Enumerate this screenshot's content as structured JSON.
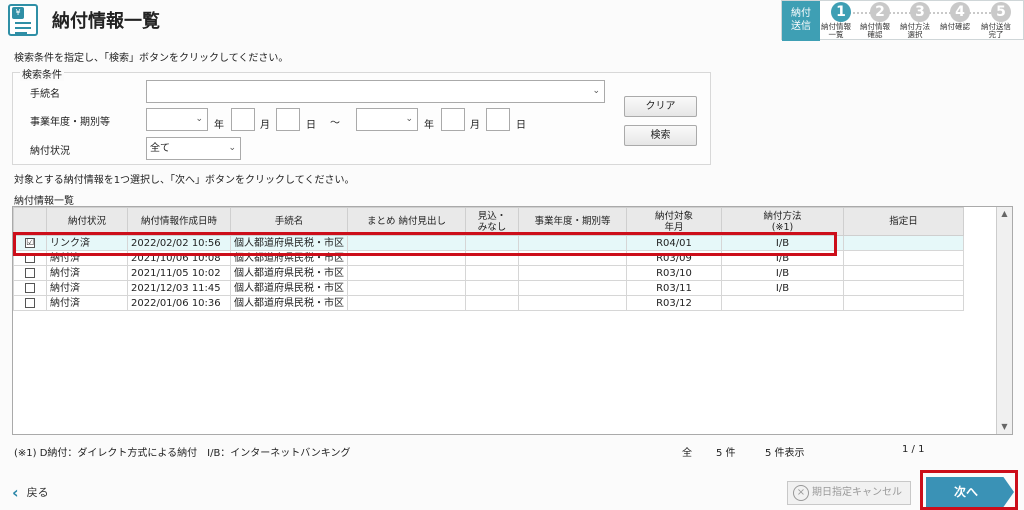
{
  "header": {
    "title": "納付情報一覧",
    "icon": "yen-document-icon"
  },
  "steps": {
    "current_label": "納付\n送信",
    "items": [
      {
        "num": "1",
        "label": "納付情報\n一覧"
      },
      {
        "num": "2",
        "label": "納付情報\n確認"
      },
      {
        "num": "3",
        "label": "納付方法\n選択"
      },
      {
        "num": "4",
        "label": "納付確認"
      },
      {
        "num": "5",
        "label": "納付送信\n完了"
      }
    ]
  },
  "instructions": {
    "search": "検索条件を指定し、「検索」ボタンをクリックしてください。",
    "select": "対象とする納付情報を1つ選択し、「次へ」ボタンをクリックしてください。"
  },
  "search": {
    "legend": "検索条件",
    "procedure_label": "手続名",
    "procedure_value": "",
    "period_label": "事業年度・期別等",
    "year_unit": "年",
    "month_unit": "月",
    "day_unit": "日",
    "tilde": "～",
    "status_label": "納付状況",
    "status_value": "全て",
    "clear_button": "クリア",
    "search_button": "検索"
  },
  "list": {
    "title": "納付情報一覧",
    "headers": [
      "",
      "納付状況",
      "納付情報作成日時",
      "手続名",
      "まとめ 納付見出し",
      "見込・\nみなし",
      "事業年度・期別等",
      "納付対象\n年月",
      "納付方法\n(※1)",
      "指定日"
    ],
    "rows": [
      {
        "checked": "☑",
        "status": "リンク済",
        "created": "2022/02/02 10:56",
        "procedure": "個人都道府県民税・市区",
        "summary": "",
        "estimate": "",
        "period": "",
        "target": "R04/01",
        "method": "I/B",
        "date": ""
      },
      {
        "checked": "",
        "status": "納付済",
        "created": "2021/10/06 10:08",
        "procedure": "個人都道府県民税・市区",
        "summary": "",
        "estimate": "",
        "period": "",
        "target": "R03/09",
        "method": "I/B",
        "date": ""
      },
      {
        "checked": "",
        "status": "納付済",
        "created": "2021/11/05 10:02",
        "procedure": "個人都道府県民税・市区",
        "summary": "",
        "estimate": "",
        "period": "",
        "target": "R03/10",
        "method": "I/B",
        "date": ""
      },
      {
        "checked": "",
        "status": "納付済",
        "created": "2021/12/03 11:45",
        "procedure": "個人都道府県民税・市区",
        "summary": "",
        "estimate": "",
        "period": "",
        "target": "R03/11",
        "method": "I/B",
        "date": ""
      },
      {
        "checked": "",
        "status": "納付済",
        "created": "2022/01/06 10:36",
        "procedure": "個人都道府県民税・市区",
        "summary": "",
        "estimate": "",
        "period": "",
        "target": "R03/12",
        "method": "",
        "date": ""
      }
    ]
  },
  "footer": {
    "note": "(※1) D納付：ダイレクト方式による納付　I/B：インターネットバンキング",
    "total_label": "全",
    "total_count": "5 件",
    "display_count": "5 件表示",
    "page": "1 / 1",
    "back": "戻る",
    "cancel": "期日指定キャンセル",
    "next": "次へ"
  },
  "colors": {
    "accent": "#3e9fb4",
    "highlight": "#cc0e1a",
    "next_button": "#3a92b6"
  }
}
